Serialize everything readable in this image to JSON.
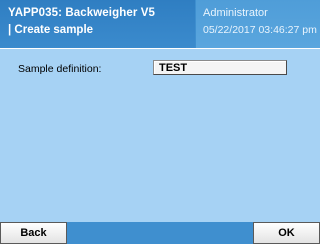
{
  "header": {
    "app_title": "YAPP035: Backweigher V5",
    "screen_title": "| Create sample",
    "user": "Administrator",
    "datetime": "05/22/2017 03:46:27 pm"
  },
  "form": {
    "sample_definition_label": "Sample definition:",
    "sample_definition_value": "TEST"
  },
  "footer": {
    "back_label": "Back",
    "ok_label": "OK"
  },
  "colors": {
    "header_left": "#3b8bcd",
    "header_right": "#5aa6de",
    "body_background": "#a6d2f4",
    "footer_background": "#3f8fcf"
  }
}
